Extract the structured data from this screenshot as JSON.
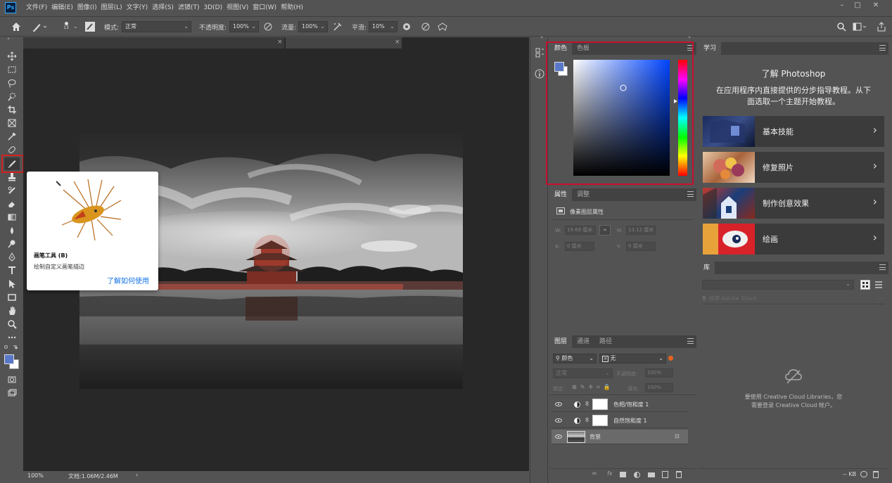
{
  "app": {
    "logo_text": "Ps"
  },
  "menu": [
    "文件(F)",
    "编辑(E)",
    "图像(I)",
    "图层(L)",
    "文字(Y)",
    "选择(S)",
    "滤镜(T)",
    "3D(D)",
    "视图(V)",
    "窗口(W)",
    "帮助(H)"
  ],
  "options": {
    "brush_size": "13",
    "mode_label": "模式:",
    "mode_value": "正常",
    "opacity_label": "不透明度:",
    "opacity_value": "100%",
    "flow_label": "流量:",
    "flow_value": "100%",
    "smooth_label": "平滑:",
    "smooth_value": "10%"
  },
  "tooltip": {
    "title": "画笔工具 (B)",
    "description": "绘制自定义画笔描边",
    "link": "了解如何使用"
  },
  "status": {
    "zoom": "100%",
    "doc": "文档:1.06M/2.46M",
    "arrow": "›"
  },
  "color_panel": {
    "tabs": [
      "颜色",
      "色板"
    ],
    "colors": {
      "foreground": "#5a78c8",
      "spectrum_base": "#0044ff",
      "highlight": "#c8102e"
    }
  },
  "properties_panel": {
    "tabs": [
      "属性",
      "调整"
    ],
    "title": "像素图层属性",
    "w_label": "W:",
    "w_value": "19.68 厘米",
    "h_label": "H:",
    "h_value": "13.12 厘米",
    "x_label": "X:",
    "x_value": "0 厘米",
    "y_label": "Y:",
    "y_value": "0 厘米"
  },
  "layers_panel": {
    "tabs": [
      "图层",
      "通道",
      "路径"
    ],
    "filter_kind": "颜色",
    "filter_value": "无",
    "blend_mode": "正常",
    "opacity_label": "不透明度:",
    "opacity_value": "100%",
    "lock_label": "锁定:",
    "fill_label": "填充:",
    "fill_value": "100%",
    "layers": [
      {
        "name": "色相/饱和度 1"
      },
      {
        "name": "自然饱和度 1"
      },
      {
        "name": "背景"
      }
    ],
    "footer_icons": [
      "link-icon",
      "fx-icon",
      "mask-icon",
      "adjustment-icon",
      "folder-icon",
      "new-layer-icon",
      "trash-icon"
    ]
  },
  "learn_panel": {
    "tab": "学习",
    "title": "了解 Photoshop",
    "subtitle_line1": "在应用程序内直接提供的分步指导教程。从下",
    "subtitle_line2": "面选取一个主题开始教程。",
    "cards": [
      {
        "label": "基本技能"
      },
      {
        "label": "修复照片"
      },
      {
        "label": "制作创意效果"
      },
      {
        "label": "绘画"
      }
    ]
  },
  "library_panel": {
    "tab": "库",
    "search_placeholder": "搜索 Adobe Stock",
    "message_line1": "要使用 Creative Cloud Libraries，您",
    "message_line2": "需要登录 Creative Cloud 帐户。",
    "footer_size": "-- KB"
  }
}
